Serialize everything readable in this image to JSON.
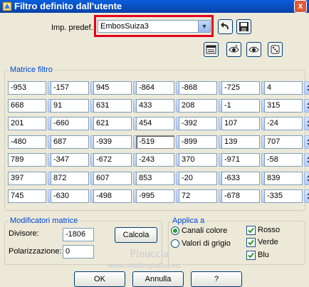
{
  "window": {
    "title": "Filtro definito dall'utente",
    "close_label": "x"
  },
  "preset": {
    "label": "Imp. predef.:",
    "value": "EmbosSuiza3"
  },
  "matrix": {
    "title": "Matrice filtro",
    "rows": [
      [
        "-953",
        "-157",
        "945",
        "-864",
        "-868",
        "-725",
        "4"
      ],
      [
        "668",
        "91",
        "631",
        "433",
        "208",
        "-1",
        "315"
      ],
      [
        "201",
        "-660",
        "621",
        "454",
        "-392",
        "107",
        "-24"
      ],
      [
        "-480",
        "687",
        "-939",
        "-519",
        "-899",
        "139",
        "707"
      ],
      [
        "789",
        "-347",
        "-672",
        "-243",
        "370",
        "-971",
        "-58"
      ],
      [
        "397",
        "872",
        "607",
        "853",
        "-20",
        "-633",
        "839"
      ],
      [
        "745",
        "-630",
        "-498",
        "-995",
        "72",
        "-678",
        "-335"
      ]
    ]
  },
  "modifiers": {
    "title": "Modificatori matrice",
    "divisor_label": "Divisore:",
    "divisor_value": "-1806",
    "compute_label": "Calcola",
    "bias_label": "Polarizzazione:",
    "bias_value": "0"
  },
  "apply": {
    "title": "Applica a",
    "radio_color": "Canali colore",
    "radio_gray": "Valori di grigio",
    "check_red": "Rosso",
    "check_green": "Verde",
    "check_blue": "Blu"
  },
  "footer": {
    "ok": "OK",
    "cancel": "Annulla",
    "help": "?"
  },
  "watermark": {
    "name": "Pinuccia",
    "url": "www.maidiregrafica.eu"
  }
}
